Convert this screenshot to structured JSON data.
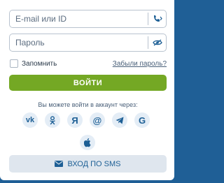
{
  "login": {
    "email_placeholder": "E-mail или ID",
    "password_placeholder": "Пароль",
    "remember_label": "Запомнить",
    "forgot_label": "Забыли пароль?",
    "submit_label": "ВОЙТИ",
    "social_caption": "Вы можете войти в аккаунт через:",
    "social": [
      {
        "icon": "vk-icon",
        "glyph": "vk"
      },
      {
        "icon": "odnoklassniki-icon",
        "glyph": ""
      },
      {
        "icon": "yandex-icon",
        "glyph": "Я"
      },
      {
        "icon": "mail-at-icon",
        "glyph": "@"
      },
      {
        "icon": "telegram-icon",
        "glyph": ""
      },
      {
        "icon": "google-icon",
        "glyph": "G"
      },
      {
        "icon": "apple-icon",
        "glyph": ""
      }
    ],
    "sms_label": "ВХОД ПО SMS"
  },
  "colors": {
    "accent_green": "#74a824",
    "brand_blue": "#1d5f95",
    "background_blue": "#1f5f96"
  }
}
